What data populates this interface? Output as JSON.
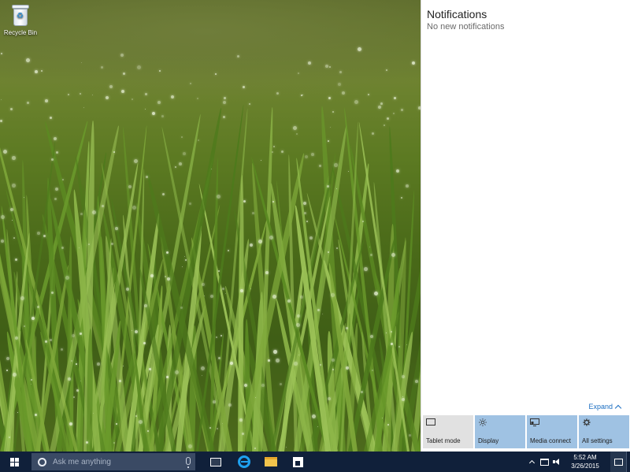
{
  "desktop": {
    "icons": [
      {
        "label": "Recycle Bin",
        "icon": "recycle-bin-icon"
      }
    ]
  },
  "action_center": {
    "title": "Notifications",
    "empty_message": "No new notifications",
    "expand_label": "Expand",
    "quick_actions": [
      {
        "label": "Tablet mode",
        "icon": "tablet-mode-icon",
        "active": false
      },
      {
        "label": "Display",
        "icon": "brightness-icon",
        "active": true
      },
      {
        "label": "Media connect",
        "icon": "media-connect-icon",
        "active": true
      },
      {
        "label": "All settings",
        "icon": "gear-icon",
        "active": true
      }
    ]
  },
  "taskbar": {
    "search_placeholder": "Ask me anything",
    "pinned": [
      "task-view-icon",
      "internet-explorer-icon",
      "file-explorer-icon",
      "store-icon"
    ],
    "clock": {
      "time": "5:52 AM",
      "date": "3/26/2015"
    }
  },
  "colors": {
    "taskbar": "#10203a",
    "tile_active": "#9fc2e3",
    "tile_inactive": "#e1e1e1",
    "accent_link": "#1b6ec2"
  }
}
